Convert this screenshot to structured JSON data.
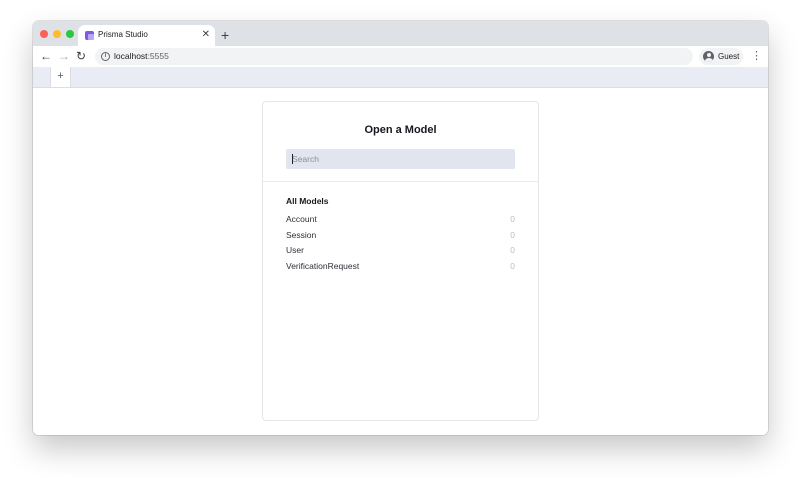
{
  "browser": {
    "tab_title": "Prisma Studio",
    "url_host": "localhost",
    "url_port": ":5555",
    "profile_label": "Guest"
  },
  "app": {
    "add_tab_label": "+"
  },
  "panel": {
    "title": "Open a Model",
    "search": {
      "placeholder": "Search",
      "value": ""
    },
    "section_title": "All Models",
    "models": [
      {
        "name": "Account",
        "count": "0"
      },
      {
        "name": "Session",
        "count": "0"
      },
      {
        "name": "User",
        "count": "0"
      },
      {
        "name": "VerificationRequest",
        "count": "0"
      }
    ]
  },
  "colors": {
    "tabstrip": "#dee1e6",
    "app_bar": "#e9ecf4",
    "search_bg": "#e1e5ee",
    "prisma_favicon": "#7c5be0"
  },
  "icons": {
    "close": "close-icon",
    "new_tab": "plus-icon",
    "back": "arrow-left-icon",
    "forward": "arrow-right-icon",
    "reload": "reload-icon",
    "info": "info-icon",
    "profile": "account-circle-icon",
    "menu": "kebab-menu-icon"
  }
}
